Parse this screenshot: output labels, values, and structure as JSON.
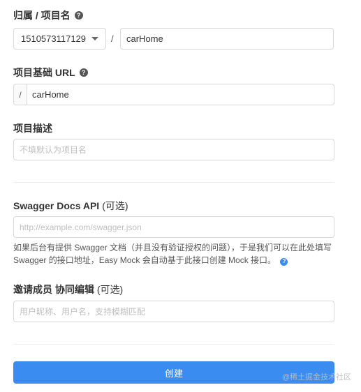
{
  "owner_project": {
    "label": "归属 / 项目名",
    "help_icon": "question-circle-icon",
    "owner_select_value": "1510573117129",
    "separator": "/",
    "project_name_value": "carHome"
  },
  "base_url": {
    "label": "项目基础 URL",
    "help_icon": "question-circle-icon",
    "prefix": "/",
    "value": "carHome"
  },
  "description": {
    "label": "项目描述",
    "placeholder": "不填默认为项目名"
  },
  "swagger": {
    "label": "Swagger Docs API",
    "optional": "(可选)",
    "placeholder": "http://example.com/swagger.json",
    "help_text": "如果后台有提供 Swagger 文档（并且没有验证授权的问题），于是我们可以在此处填写 Swagger 的接口地址，Easy Mock 会自动基于此接口创建 Mock 接口。"
  },
  "members": {
    "label": "邀请成员 协同编辑",
    "optional": "(可选)",
    "placeholder": "用户昵称、用户名，支持模糊匹配"
  },
  "create_button": "创建",
  "watermark": "@稀土掘金技术社区",
  "colors": {
    "primary": "#3b8cf0",
    "border": "#d9d9d9",
    "placeholder": "#bfbfbf"
  }
}
